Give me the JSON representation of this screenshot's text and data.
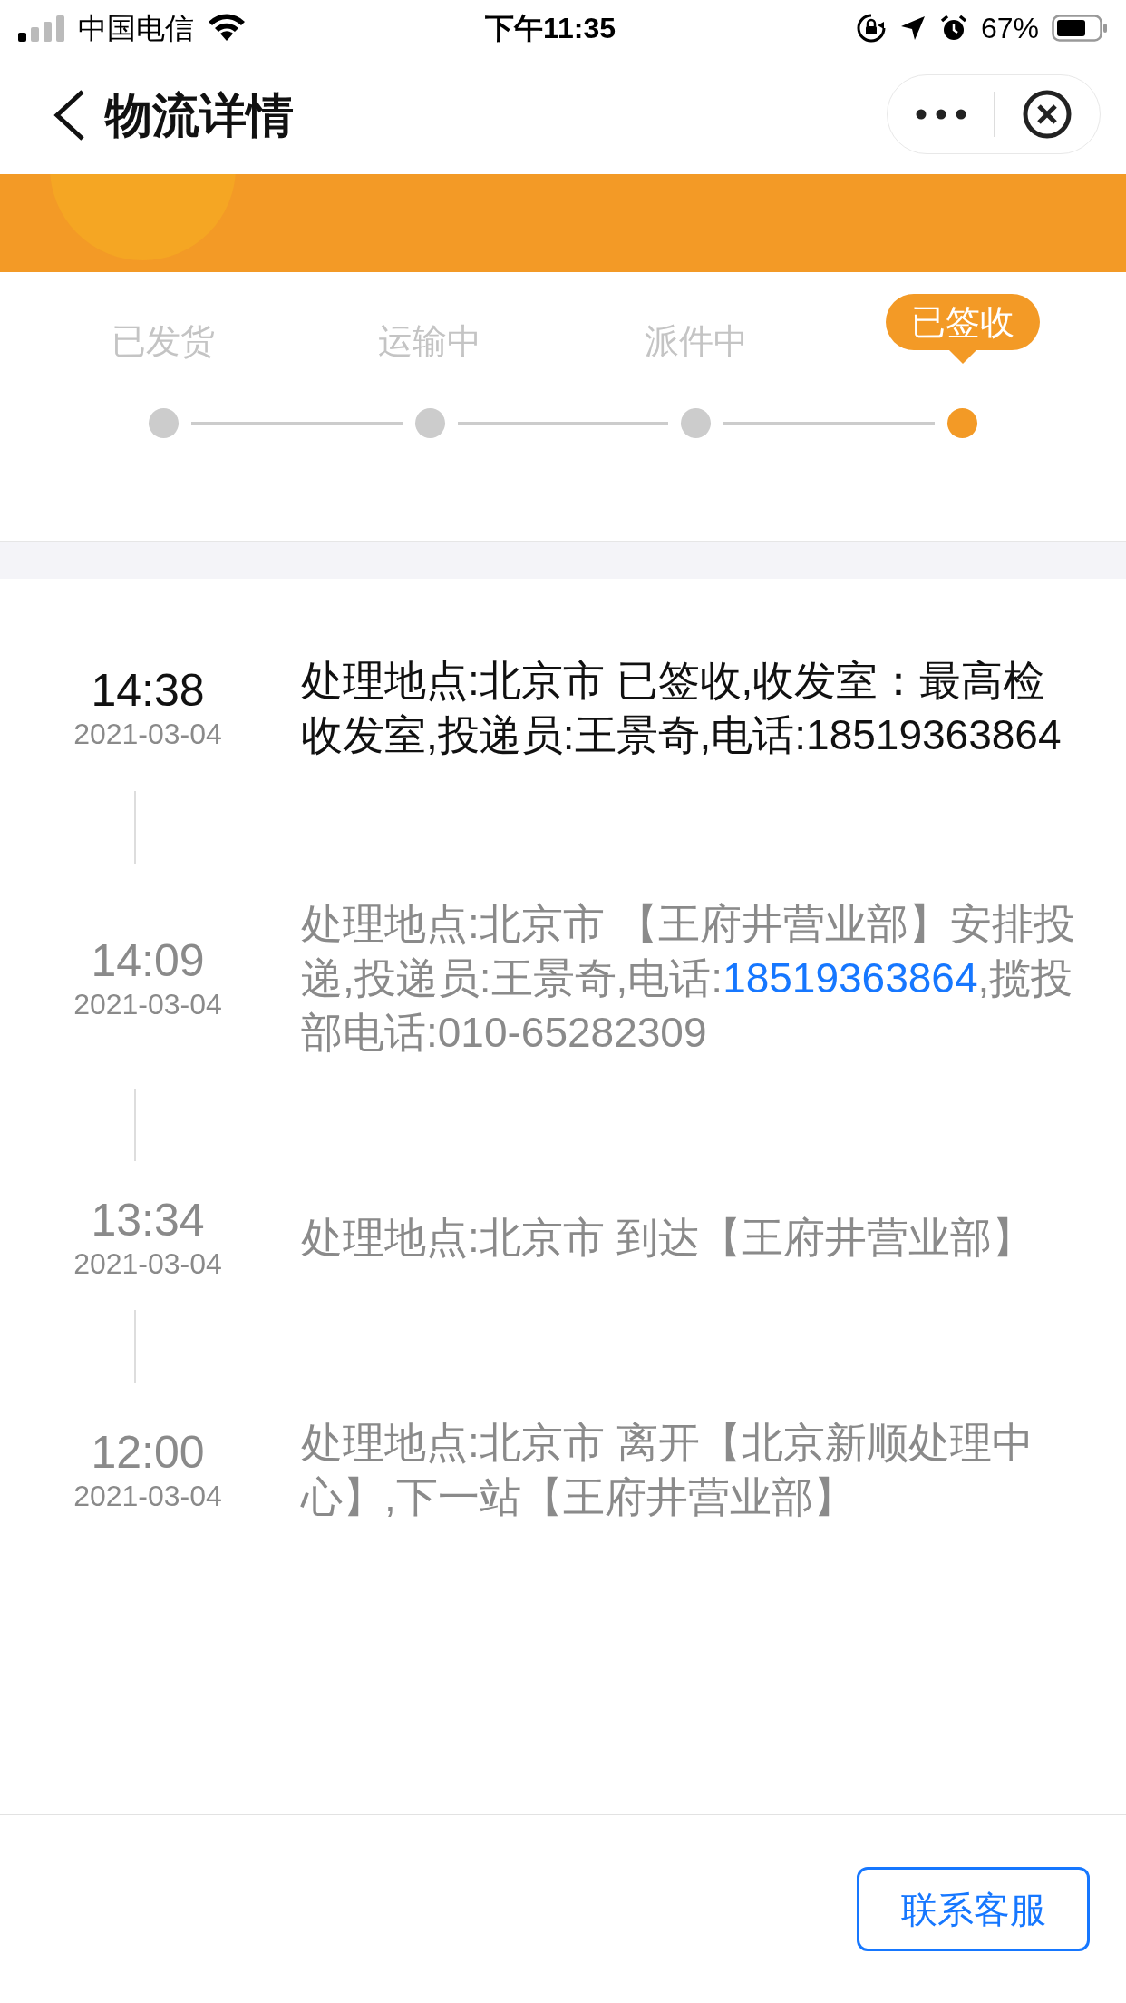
{
  "status_bar": {
    "carrier": "中国电信",
    "time": "下午11:35",
    "battery": "67%"
  },
  "header": {
    "title": "物流详情"
  },
  "steps": [
    {
      "label": "已发货",
      "selected": false
    },
    {
      "label": "运输中",
      "selected": false
    },
    {
      "label": "派件中",
      "selected": false
    },
    {
      "label": "已签收",
      "selected": true
    }
  ],
  "events": [
    {
      "time": "14:38",
      "date": "2021-03-04",
      "current": true,
      "segments": [
        {
          "kind": "text",
          "text": "处理地点:北京市 已签收,收发室：最高检收发室,投递员:王景奇,电话:18519363864"
        }
      ]
    },
    {
      "time": "14:09",
      "date": "2021-03-04",
      "current": false,
      "segments": [
        {
          "kind": "text",
          "text": "处理地点:北京市 【王府井营业部】安排投递,投递员:王景奇,电话:"
        },
        {
          "kind": "link",
          "text": "18519363864"
        },
        {
          "kind": "text",
          "text": ",揽投部电话:010-65282309"
        }
      ]
    },
    {
      "time": "13:34",
      "date": "2021-03-04",
      "current": false,
      "segments": [
        {
          "kind": "text",
          "text": "处理地点:北京市 到达【王府井营业部】"
        }
      ]
    },
    {
      "time": "12:00",
      "date": "2021-03-04",
      "current": false,
      "segments": [
        {
          "kind": "text",
          "text": "处理地点:北京市 离开【北京新顺处理中心】,下一站【王府井营业部】"
        }
      ]
    }
  ],
  "footer": {
    "button": "联系客服"
  }
}
